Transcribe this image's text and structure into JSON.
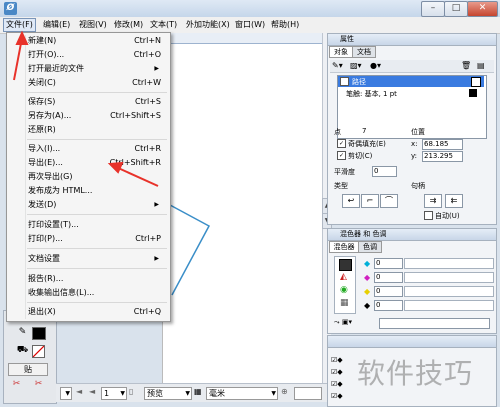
{
  "menubar": {
    "items": [
      "文件(F)",
      "编辑(E)",
      "视图(V)",
      "修改(M)",
      "文本(T)",
      "外加功能(X)",
      "窗口(W)",
      "帮助(H)"
    ]
  },
  "file_menu": {
    "items": [
      {
        "label": "新建(N)",
        "shortcut": "Ctrl+N"
      },
      {
        "label": "打开(O)...",
        "shortcut": "Ctrl+O"
      },
      {
        "label": "打开最近的文件",
        "shortcut": ""
      },
      {
        "label": "关闭(C)",
        "shortcut": "Ctrl+W"
      },
      {
        "label": "保存(S)",
        "shortcut": "Ctrl+S"
      },
      {
        "label": "另存为(A)...",
        "shortcut": "Ctrl+Shift+S"
      },
      {
        "label": "还原(R)",
        "shortcut": ""
      },
      {
        "label": "导入(I)...",
        "shortcut": "Ctrl+R"
      },
      {
        "label": "导出(E)...",
        "shortcut": "Ctrl+Shift+R"
      },
      {
        "label": "再次导出(G)",
        "shortcut": ""
      },
      {
        "label": "发布成为 HTML...",
        "shortcut": ""
      },
      {
        "label": "发送(D)",
        "shortcut": ""
      },
      {
        "label": "打印设置(T)...",
        "shortcut": ""
      },
      {
        "label": "打印(P)...",
        "shortcut": "Ctrl+P"
      },
      {
        "label": "文档设置",
        "shortcut": ""
      },
      {
        "label": "报告(R)...",
        "shortcut": ""
      },
      {
        "label": "收集输出信息(L)...",
        "shortcut": ""
      },
      {
        "label": "退出(X)",
        "shortcut": "Ctrl+Q"
      }
    ]
  },
  "tools": {
    "pen_label": "贴"
  },
  "statusbar": {
    "page_value": "1",
    "view_mode": "预览",
    "unit": "毫米"
  },
  "properties_panel": {
    "title": "属性",
    "tabs": [
      "对象",
      "文档"
    ],
    "list": {
      "selected_item": "路径",
      "sub_item": "笔触: 基本, 1 pt"
    },
    "point_label": "点",
    "point_value": "7",
    "even_odd_fill": "奇偶填充(E)",
    "clip": "剪切(C)",
    "smoothness_label": "平滑度",
    "smoothness_value": "0",
    "type_label": "类型",
    "position_label": "位置",
    "x_label": "x:",
    "x_value": "68.185",
    "y_label": "y:",
    "y_value": "213.295",
    "handles_label": "句柄",
    "auto_label": "自动(U)"
  },
  "mixer_panel": {
    "title": "混色器 和 色调",
    "tabs": [
      "混色器",
      "色调"
    ],
    "channels": [
      {
        "value": "0",
        "color": "#00b0d8"
      },
      {
        "value": "0",
        "color": "#d020c0"
      },
      {
        "value": "0",
        "color": "#e8d000"
      },
      {
        "value": "0",
        "color": "#000000"
      }
    ]
  },
  "annotation": {
    "watermark": "软件技巧",
    "arrow_color": "#e8322a",
    "line_color": "#3a8ec8"
  }
}
